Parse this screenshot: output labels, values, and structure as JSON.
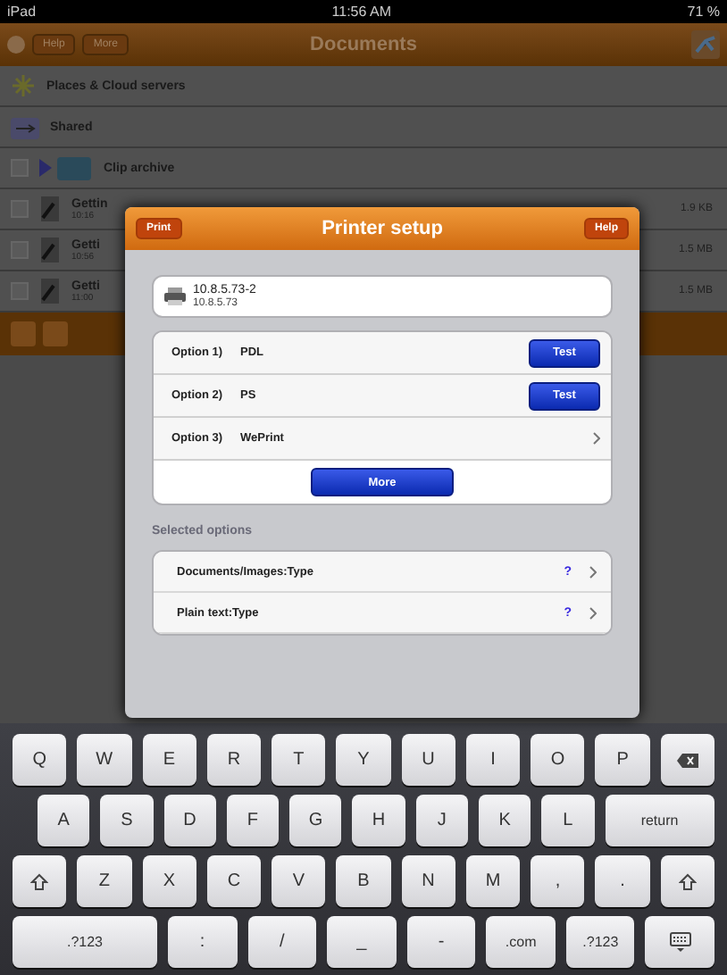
{
  "status_bar": {
    "device": "iPad",
    "time": "11:56 AM",
    "battery": "71 %"
  },
  "nav_bar": {
    "title": "Documents",
    "buttons": [
      "Help",
      "More"
    ]
  },
  "places": [
    {
      "label": "Places & Cloud servers",
      "kind": "places"
    },
    {
      "label": "Shared",
      "kind": "shared"
    },
    {
      "label": "Clip archive",
      "kind": "folder",
      "checked": false
    }
  ],
  "files": [
    {
      "name": "Gettin",
      "time": "10:16",
      "size": "1.9 KB",
      "checked": false
    },
    {
      "name": "Getti",
      "time": "10:56",
      "size": "1.5 MB",
      "checked": false
    },
    {
      "name": "Getti",
      "time": "11:00",
      "size": "1.5 MB",
      "checked": false
    }
  ],
  "dialog": {
    "title": "Printer setup",
    "back_button": "Print",
    "help_button": "Help",
    "printer": {
      "name": "10.8.5.73-2",
      "address": "10.8.5.73"
    },
    "options": [
      {
        "number": "Option 1)",
        "name": "PDL",
        "kind": "test",
        "button": "Test"
      },
      {
        "number": "Option 2)",
        "name": "PS",
        "kind": "test",
        "button": "Test"
      },
      {
        "number": "Option 3)",
        "name": "WePrint",
        "kind": "link"
      }
    ],
    "more_button": "More",
    "section_title": "Selected options",
    "selected_options": [
      {
        "label": "Documents/Images:Type",
        "hint": "?"
      },
      {
        "label": "Plain text:Type",
        "hint": "?"
      }
    ]
  },
  "keyboard": [
    [
      {
        "kind": "char",
        "label": "Q"
      },
      {
        "kind": "char",
        "label": "W"
      },
      {
        "kind": "char",
        "label": "E"
      },
      {
        "kind": "char",
        "label": "R"
      },
      {
        "kind": "char",
        "label": "T"
      },
      {
        "kind": "char",
        "label": "Y"
      },
      {
        "kind": "char",
        "label": "U"
      },
      {
        "kind": "char",
        "label": "I"
      },
      {
        "kind": "char",
        "label": "O"
      },
      {
        "kind": "char",
        "label": "P"
      },
      {
        "kind": "backspace"
      }
    ],
    [
      {
        "kind": "char",
        "label": "A"
      },
      {
        "kind": "char",
        "label": "S"
      },
      {
        "kind": "char",
        "label": "D"
      },
      {
        "kind": "char",
        "label": "F"
      },
      {
        "kind": "char",
        "label": "G"
      },
      {
        "kind": "char",
        "label": "H"
      },
      {
        "kind": "char",
        "label": "J"
      },
      {
        "kind": "char",
        "label": "K"
      },
      {
        "kind": "char",
        "label": "L"
      },
      {
        "kind": "wide",
        "label": "return"
      }
    ],
    [
      {
        "kind": "shift"
      },
      {
        "kind": "char",
        "label": "Z"
      },
      {
        "kind": "char",
        "label": "X"
      },
      {
        "kind": "char",
        "label": "C"
      },
      {
        "kind": "char",
        "label": "V"
      },
      {
        "kind": "char",
        "label": "B"
      },
      {
        "kind": "char",
        "label": "N"
      },
      {
        "kind": "char",
        "label": "M"
      },
      {
        "kind": "char",
        "label": ","
      },
      {
        "kind": "char",
        "label": "."
      },
      {
        "kind": "shift"
      }
    ],
    [
      {
        "kind": "wide",
        "label": ".?123"
      },
      {
        "kind": "char",
        "label": ":"
      },
      {
        "kind": "char",
        "label": "/"
      },
      {
        "kind": "char",
        "label": "_"
      },
      {
        "kind": "char",
        "label": "-"
      },
      {
        "kind": "char",
        "label": ".com"
      },
      {
        "kind": "char",
        "label": ".?123"
      },
      {
        "kind": "hide"
      }
    ]
  ]
}
